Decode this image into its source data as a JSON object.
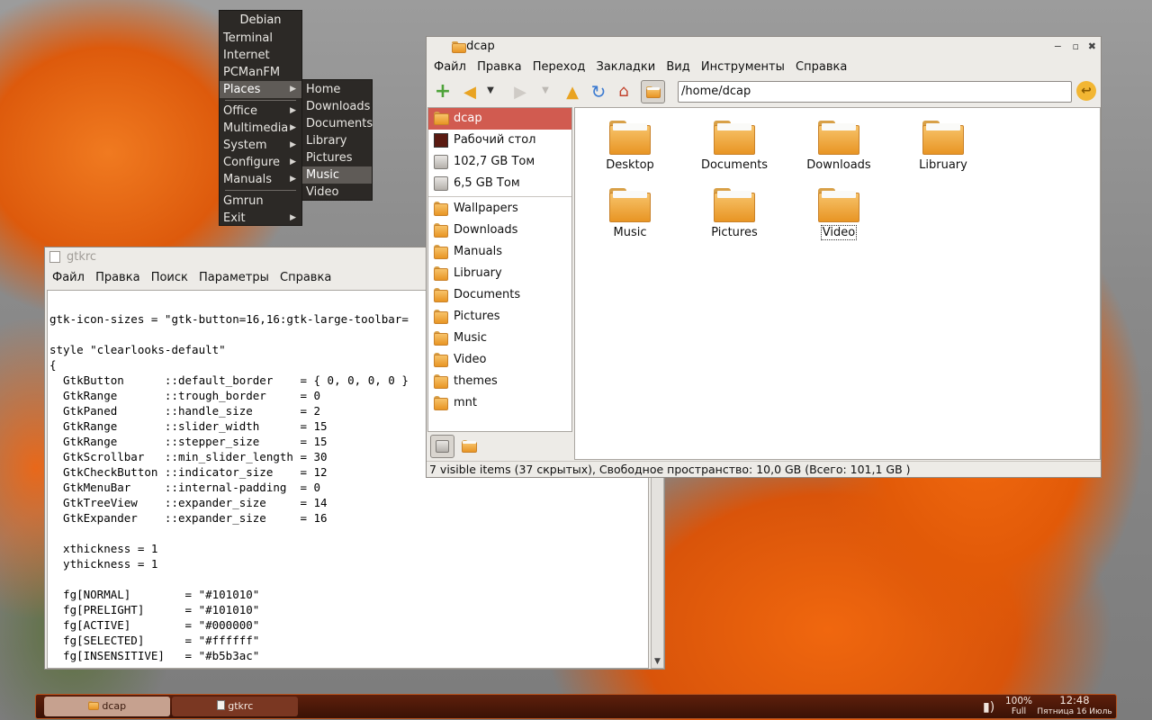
{
  "menu": {
    "header": "Debian",
    "items": [
      {
        "label": "Terminal",
        "submenu": false
      },
      {
        "label": "Internet",
        "submenu": false
      },
      {
        "label": "PCManFM",
        "submenu": false
      },
      {
        "label": "Places",
        "submenu": true
      },
      {
        "label": "Office",
        "submenu": true
      },
      {
        "label": "Multimedia",
        "submenu": true
      },
      {
        "label": "System",
        "submenu": true
      },
      {
        "label": "Configure",
        "submenu": true
      },
      {
        "label": "Manuals",
        "submenu": true
      },
      {
        "label": "Gmrun",
        "submenu": false
      },
      {
        "label": "Exit",
        "submenu": true
      }
    ],
    "places_submenu": [
      "Home",
      "Downloads",
      "Documents",
      "Library",
      "Pictures",
      "Music",
      "Video"
    ],
    "selected_submenu": "Music"
  },
  "fm": {
    "title": "dcap",
    "menubar": [
      "Файл",
      "Правка",
      "Переход",
      "Закладки",
      "Вид",
      "Инструменты",
      "Справка"
    ],
    "path": "/home/dcap",
    "sidebar_places": [
      {
        "label": "dcap",
        "icon": "home-folder-icon",
        "selected": true
      },
      {
        "label": "Рабочий стол",
        "icon": "desktop-icon"
      },
      {
        "label": "102,7 GB Том",
        "icon": "drive-icon"
      },
      {
        "label": "6,5 GB Том",
        "icon": "drive-icon"
      }
    ],
    "sidebar_bookmarks": [
      "Wallpapers",
      "Downloads",
      "Manuals",
      "Libruary",
      "Documents",
      "Pictures",
      "Music",
      "Video",
      "themes",
      "mnt"
    ],
    "items": [
      "Desktop",
      "Documents",
      "Downloads",
      "Libruary",
      "Music",
      "Pictures",
      "Video"
    ],
    "status": "7 visible items (37 скрытых), Свободное пространство: 10,0 GB (Всего: 101,1 GB )",
    "colors": {
      "selection": "#d15b50",
      "folder": "#f0ae45"
    }
  },
  "editor": {
    "title": "gtkrc",
    "menubar": [
      "Файл",
      "Правка",
      "Поиск",
      "Параметры",
      "Справка"
    ],
    "code": "\ngtk-icon-sizes = \"gtk-button=16,16:gtk-large-toolbar=\n\nstyle \"clearlooks-default\"\n{\n  GtkButton      ::default_border    = { 0, 0, 0, 0 }\n  GtkRange       ::trough_border     = 0\n  GtkPaned       ::handle_size       = 2\n  GtkRange       ::slider_width      = 15\n  GtkRange       ::stepper_size      = 15\n  GtkScrollbar   ::min_slider_length = 30\n  GtkCheckButton ::indicator_size    = 12\n  GtkMenuBar     ::internal-padding  = 0\n  GtkTreeView    ::expander_size     = 14\n  GtkExpander    ::expander_size     = 16\n\n  xthickness = 1\n  ythickness = 1\n\n  fg[NORMAL]        = \"#101010\"\n  fg[PRELIGHT]      = \"#101010\"\n  fg[ACTIVE]        = \"#000000\"\n  fg[SELECTED]      = \"#ffffff\"\n  fg[INSENSITIVE]   = \"#b5b3ac\""
  },
  "taskbar": {
    "tasks": [
      {
        "label": "dcap",
        "icon": "folder-icon",
        "active": true
      },
      {
        "label": "gtkrc",
        "icon": "text-editor-icon",
        "active": false
      }
    ],
    "battery_percent": "100%",
    "battery_state": "Full",
    "time": "12:48",
    "date": "Пятница 16 Июль"
  }
}
